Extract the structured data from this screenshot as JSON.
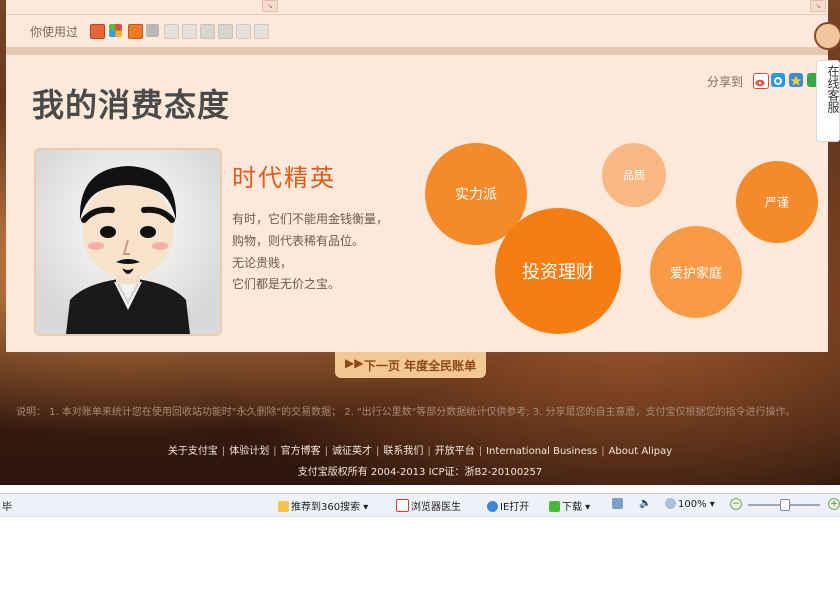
{
  "used": {
    "label": "你使用过"
  },
  "share": {
    "label": "分享到"
  },
  "page_title": "我的消费态度",
  "persona": {
    "name": "时代精英",
    "lines": [
      "有时，它们不能用金钱衡量，",
      "购物，则代表稀有品位。",
      "无论贵贱，",
      "它们都是无价之宝。"
    ]
  },
  "bubbles": [
    "实力派",
    "品质",
    "严谨",
    "投资理财",
    "爱护家庭"
  ],
  "next": {
    "label": "下一页 年度全民账单"
  },
  "note": "说明： 1. 本对账单来统计您在使用回收站功能时\"永久删除\"的交易数据； 2. \"出行公里数\"等部分数据统计仅供参考; 3. 分享是您的自主意愿，支付宝仅根据您的指令进行操作。",
  "footer": {
    "links": [
      "关于支付宝",
      "体验计划",
      "官方博客",
      "诚征英才",
      "联系我们",
      "开放平台",
      "International Business",
      "About Alipay"
    ],
    "copyright": "支付宝版权所有 2004-2013 ICP证：浙B2-20100257"
  },
  "side_service": {
    "label": "在线客服"
  },
  "statusbar": {
    "left": "毕",
    "recommend": "推荐到360搜索",
    "doctor": "浏览器医生",
    "ie_open": "IE打开",
    "download": "下载",
    "zoom": "100%"
  },
  "colors": {
    "accent_orange": "#f57d12",
    "bubble_light": "#f8b882",
    "card_bg": "#fde9da"
  }
}
